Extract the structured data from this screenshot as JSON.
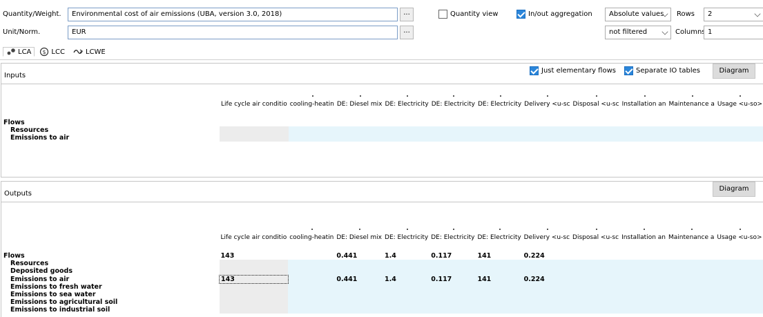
{
  "top": {
    "quantity_label": "Quantity/Weight.",
    "quantity_value": "Environmental cost of air emissions (UBA, version 3.0, 2018)",
    "unit_label": "Unit/Norm.",
    "unit_value": "EUR",
    "dots_label": "...",
    "quantity_view_label": "Quantity view",
    "quantity_view_checked": false,
    "inout_label": "In/out aggregation",
    "inout_checked": true,
    "absolute_values": "Absolute values",
    "not_filtered": "not filtered",
    "rows_label": "Rows",
    "rows_value": "2",
    "columns_label": "Columns",
    "columns_value": "1"
  },
  "tabs": [
    {
      "label": "LCA",
      "icon": "lca-icon",
      "active": true
    },
    {
      "label": "LCC",
      "icon": "lcc-icon",
      "active": false
    },
    {
      "label": "LCWE",
      "icon": "lcwe-icon",
      "active": false
    }
  ],
  "inputs": {
    "title": "Inputs",
    "just_elementary_label": "Just elementary flows",
    "separate_io_label": "Separate IO tables",
    "diagram_label": "Diagram",
    "columns": [
      "Life cycle air conditio",
      "cooling-heatin",
      "DE: Diesel mix",
      "DE: Electricity",
      "DE: Electricity",
      "DE: Electricity",
      "Delivery <u-sc",
      "Disposal <u-sc",
      "Installation an",
      "Maintenance a",
      "Usage <u-so>"
    ],
    "rows": [
      {
        "name": "Flows",
        "indent": false,
        "values": [
          "",
          "",
          "",
          "",
          "",
          "",
          "",
          "",
          "",
          "",
          ""
        ]
      },
      {
        "name": "Resources",
        "indent": true,
        "values": [
          "",
          "",
          "",
          "",
          "",
          "",
          "",
          "",
          "",
          "",
          ""
        ]
      },
      {
        "name": "Emissions to air",
        "indent": true,
        "values": [
          "",
          "",
          "",
          "",
          "",
          "",
          "",
          "",
          "",
          "",
          ""
        ]
      }
    ]
  },
  "outputs": {
    "title": "Outputs",
    "diagram_label": "Diagram",
    "columns": [
      "Life cycle air conditio",
      "cooling-heatin",
      "DE: Diesel mix",
      "DE: Electricity",
      "DE: Electricity",
      "DE: Electricity",
      "Delivery <u-sc",
      "Disposal <u-sc",
      "Installation an",
      "Maintenance a",
      "Usage <u-so>"
    ],
    "rows": [
      {
        "name": "Flows",
        "indent": false,
        "values": [
          "143",
          "",
          "0.441",
          "1.4",
          "0.117",
          "141",
          "0.224",
          "",
          "",
          "",
          ""
        ]
      },
      {
        "name": "Resources",
        "indent": true,
        "values": [
          "",
          "",
          "",
          "",
          "",
          "",
          "",
          "",
          "",
          "",
          ""
        ]
      },
      {
        "name": "Deposited goods",
        "indent": true,
        "values": [
          "",
          "",
          "",
          "",
          "",
          "",
          "",
          "",
          "",
          "",
          ""
        ]
      },
      {
        "name": "Emissions to air",
        "indent": true,
        "values": [
          "143",
          "",
          "0.441",
          "1.4",
          "0.117",
          "141",
          "0.224",
          "",
          "",
          "",
          ""
        ]
      },
      {
        "name": "Emissions to fresh water",
        "indent": true,
        "values": [
          "",
          "",
          "",
          "",
          "",
          "",
          "",
          "",
          "",
          "",
          ""
        ]
      },
      {
        "name": "Emissions to sea water",
        "indent": true,
        "values": [
          "",
          "",
          "",
          "",
          "",
          "",
          "",
          "",
          "",
          "",
          ""
        ]
      },
      {
        "name": "Emissions to agricultural soil",
        "indent": true,
        "values": [
          "",
          "",
          "",
          "",
          "",
          "",
          "",
          "",
          "",
          "",
          ""
        ]
      },
      {
        "name": "Emissions to industrial soil",
        "indent": true,
        "values": [
          "",
          "",
          "",
          "",
          "",
          "",
          "",
          "",
          "",
          "",
          ""
        ]
      }
    ]
  }
}
